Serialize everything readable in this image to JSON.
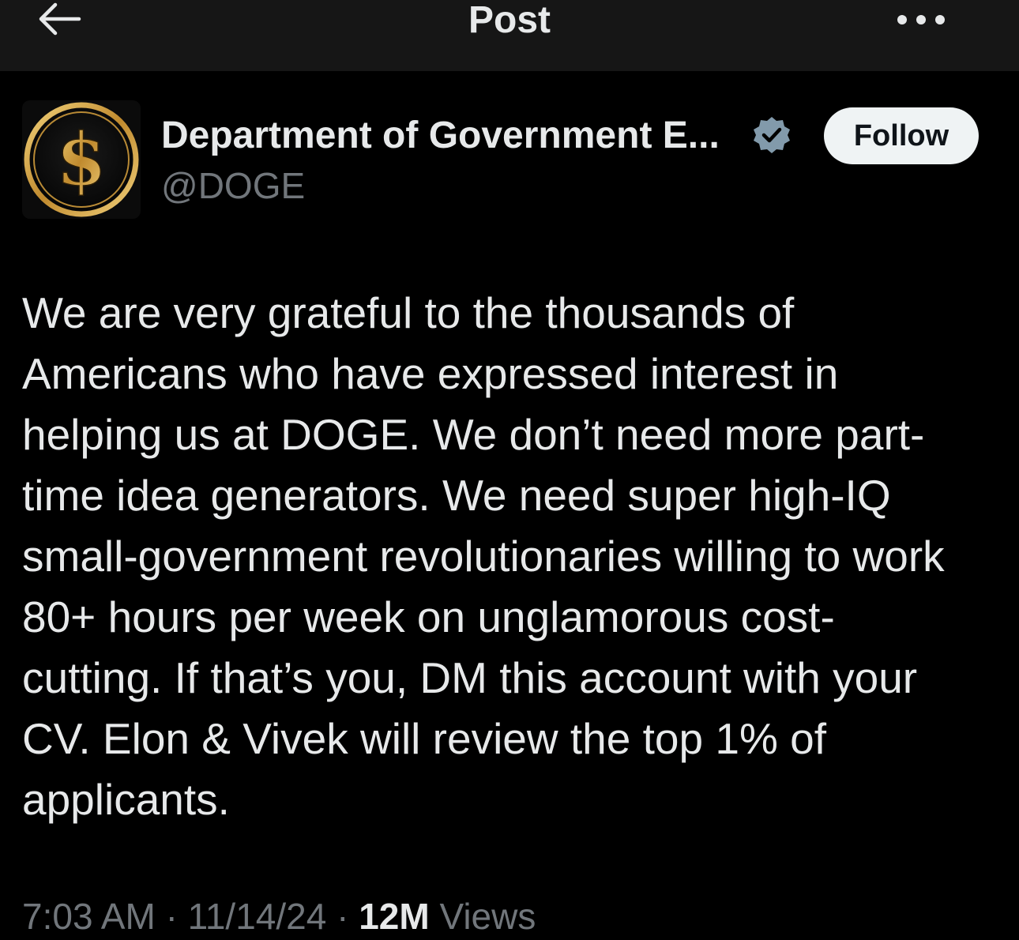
{
  "header": {
    "title": "Post",
    "back_icon": "arrow-left-icon",
    "more_icon": "more-horizontal-icon"
  },
  "author": {
    "display_name": "Department of Government E...",
    "handle": "@DOGE",
    "verified": true,
    "avatar_symbol": "$",
    "follow_label": "Follow"
  },
  "post": {
    "lines": [
      "We are very grateful to the thousands of",
      "Americans who have expressed interest in",
      "helping us at DOGE. We don’t need more part-",
      "time idea generators. We need super high-IQ",
      "small-government revolutionaries willing to work",
      "80+ hours per week on unglamorous cost-",
      "cutting. If that’s you, DM this account with your",
      "CV. Elon & Vivek will review the top 1% of",
      "applicants."
    ],
    "time": "7:03 AM",
    "date": "11/14/24",
    "views_count": "12M",
    "views_label": "Views"
  },
  "colors": {
    "background": "#000000",
    "topbar": "#161616",
    "text": "#e7e9ea",
    "secondary_text": "#71767b",
    "verified": "#829aab",
    "gold": "#d4a64a"
  }
}
